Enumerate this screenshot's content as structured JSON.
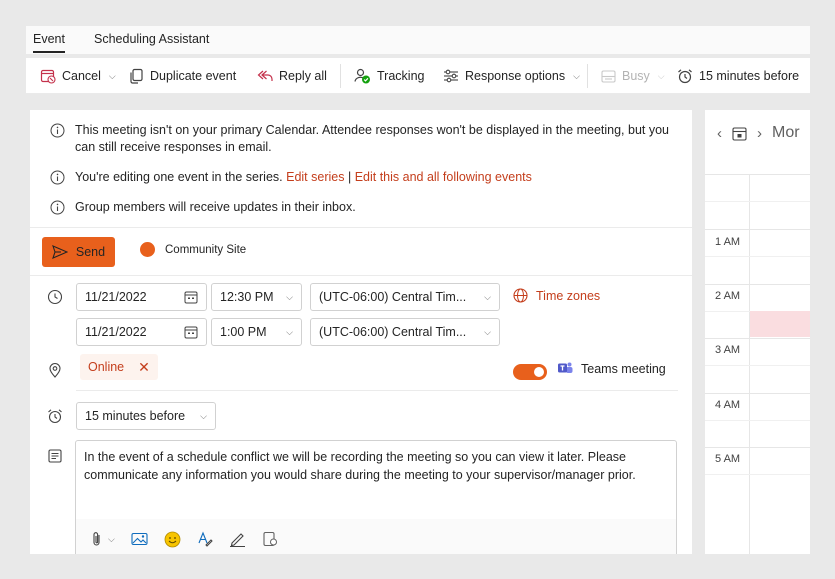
{
  "tabs": [
    {
      "label": "Event"
    },
    {
      "label": "Scheduling Assistant"
    }
  ],
  "ribbon": {
    "cancel": "Cancel",
    "duplicate": "Duplicate event",
    "reply_all": "Reply all",
    "tracking": "Tracking",
    "response_options": "Response options",
    "busy": "Busy",
    "reminder": "15 minutes before"
  },
  "info": {
    "primary_calendar": "This meeting isn't on your primary Calendar. Attendee responses won't be displayed in the meeting, but you can still receive responses in email.",
    "editing_prefix": "You're editing one event in the series.",
    "edit_series": "Edit series",
    "separator": "|",
    "edit_following": "Edit this and all following events",
    "group_members": "Group members will receive updates in their inbox."
  },
  "send_label": "Send",
  "calendar_name": "Community Site",
  "calendar_color": "#e8601c",
  "accent_color": "#e8601c",
  "link_color": "#c43e1c",
  "start": {
    "date": "11/21/2022",
    "time": "12:30 PM",
    "timezone": "(UTC-06:00) Central Tim..."
  },
  "end": {
    "date": "11/21/2022",
    "time": "1:00 PM",
    "timezone": "(UTC-06:00) Central Tim..."
  },
  "time_zones_label": "Time zones",
  "location_chip": "Online",
  "teams_label": "Teams meeting",
  "teams_toggle_on": true,
  "reminder_value": "15 minutes before",
  "body_text": "In the event of a schedule conflict we will be recording the meeting so you can view it later. Please communicate any information you would share during the meeting to your supervisor/manager prior.",
  "calendar_pane": {
    "header": "Mor",
    "hours": [
      "1 AM",
      "2 AM",
      "3 AM",
      "4 AM",
      "5 AM"
    ],
    "event_slot_color": "#fadde0"
  },
  "icons": {
    "cancel": "calendar-cancel-icon",
    "duplicate": "copy-icon",
    "reply_all": "reply-all-icon",
    "tracking": "person-check-icon",
    "response_options": "options-icon",
    "busy": "busy-status-icon",
    "reminder": "alarm-clock-icon",
    "info": "info-icon",
    "send": "send-icon",
    "clock": "clock-icon",
    "date_picker": "calendar-icon",
    "globe": "globe-icon",
    "location": "location-pin-icon",
    "teams": "teams-icon",
    "notes": "notes-icon",
    "attach": "paperclip-icon",
    "image": "image-icon",
    "emoji": "emoji-icon",
    "format": "format-icon",
    "signature": "signature-icon",
    "loop": "loop-component-icon"
  }
}
